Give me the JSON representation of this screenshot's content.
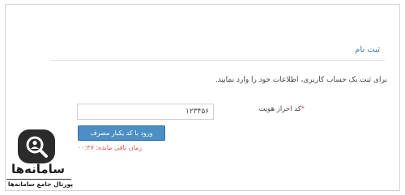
{
  "form": {
    "title": "ثبت نام",
    "instruction": "برای ثبت یک حساب کاربری، اطلاعات خود را وارد نمایید.",
    "field_label": "کد احراز هویت",
    "required_mark": "*",
    "field_value": "۱۲۳۴۵۶",
    "submit_label": "ورود با کد یکبار مصرف",
    "timer_text": "زمان باقی مانده: ۰۰:۳۷"
  },
  "logo": {
    "name": "سامانه‌ها",
    "tagline": "پورتال جامع سامانه‌ها"
  },
  "colors": {
    "accent": "#3f80b8",
    "button": "#4d8fc4",
    "error": "#d9534f"
  },
  "icons": {
    "logo": "search-user-icon"
  }
}
